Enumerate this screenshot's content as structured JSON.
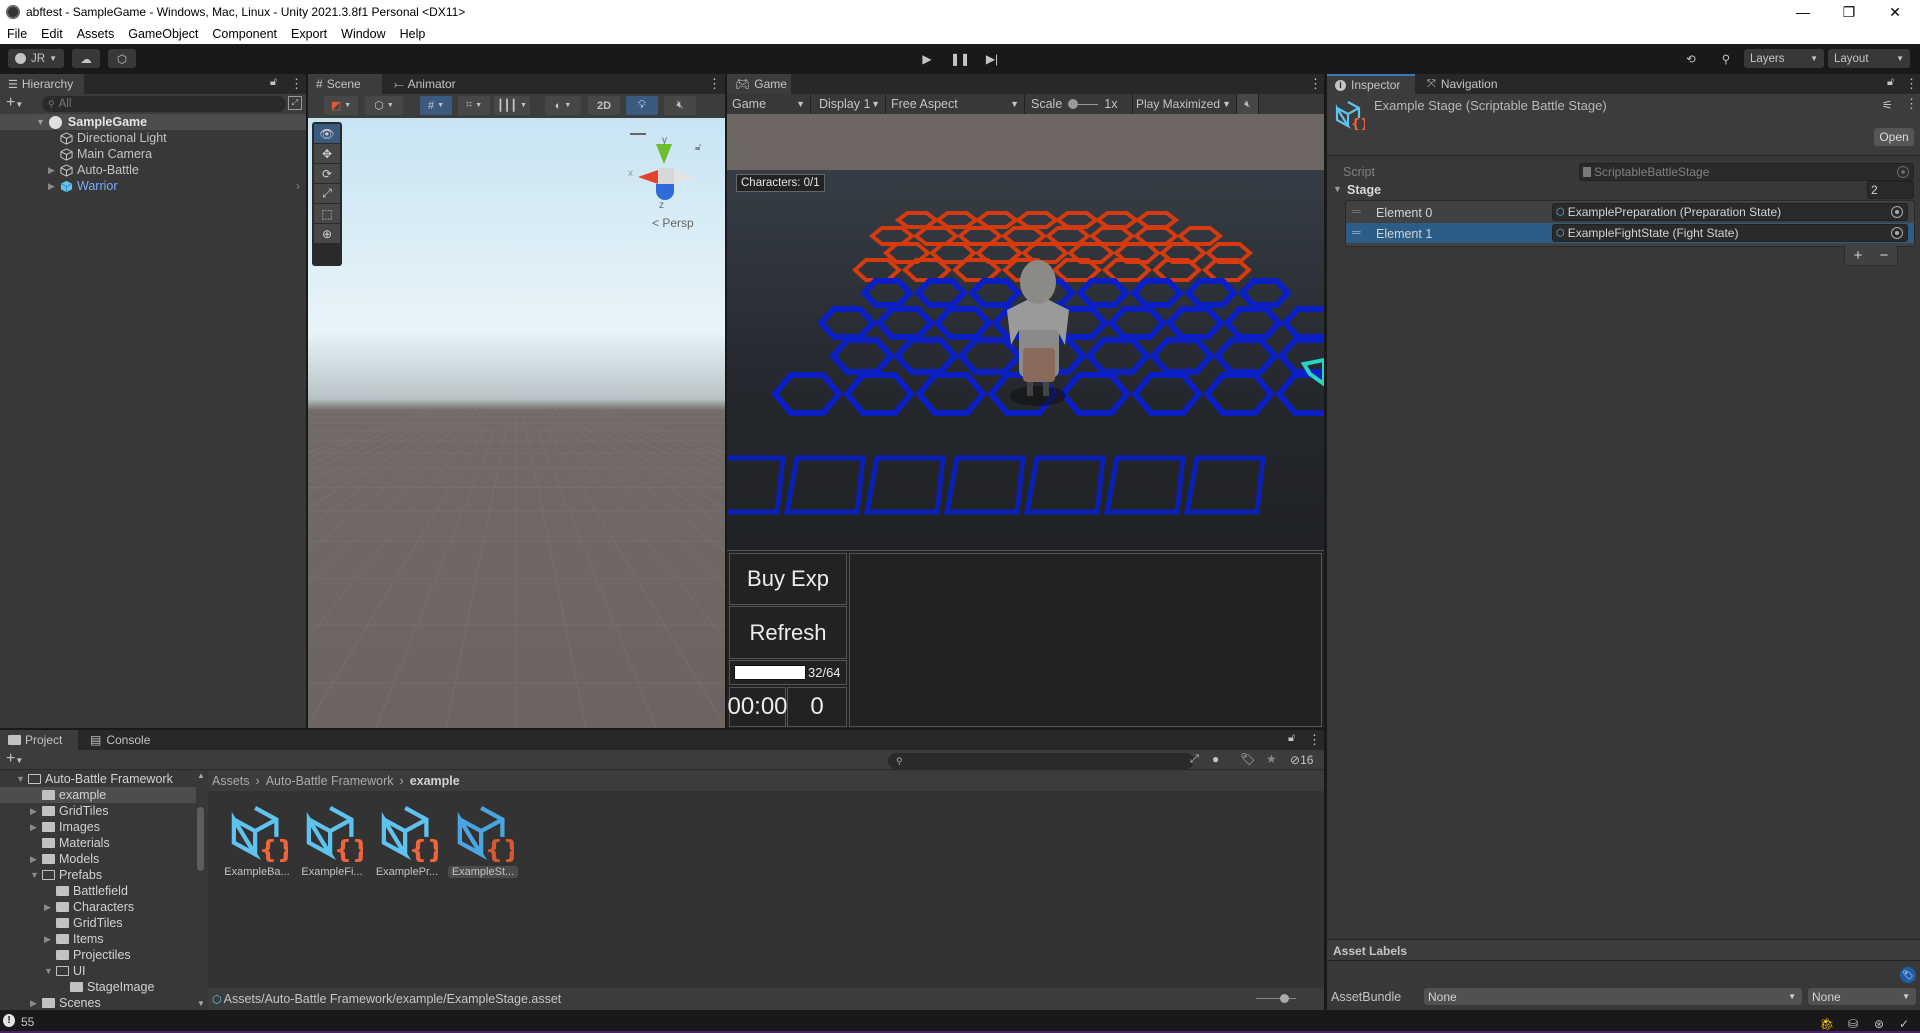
{
  "window": {
    "title": "abftest - SampleGame - Windows, Mac, Linux - Unity 2021.3.8f1 Personal <DX11>",
    "controls": {
      "minimize": "—",
      "maximize": "❐",
      "close": "✕"
    }
  },
  "menu": [
    "File",
    "Edit",
    "Assets",
    "GameObject",
    "Component",
    "Export",
    "Window",
    "Help"
  ],
  "toolbar": {
    "account_label": "JR",
    "cloud_icon": "cloud-icon",
    "collab_icon": "package-icon",
    "play_icons": [
      "play-icon",
      "pause-icon",
      "step-icon"
    ],
    "layers_label": "Layers",
    "layout_label": "Layout"
  },
  "hierarchy": {
    "tab_label": "Hierarchy",
    "search_placeholder": "All",
    "scene_name": "SampleGame",
    "items": [
      {
        "label": "Directional Light",
        "expandable": false,
        "prefab": false
      },
      {
        "label": "Main Camera",
        "expandable": false,
        "prefab": false
      },
      {
        "label": "Auto-Battle",
        "expandable": true,
        "prefab": false
      },
      {
        "label": "Warrior",
        "expandable": true,
        "prefab": true
      }
    ]
  },
  "scene": {
    "tabs": [
      {
        "label": "Scene",
        "icon": "grid-hash-icon"
      },
      {
        "label": "Animator",
        "icon": "animator-icon"
      }
    ],
    "toolbar": {
      "btn_2d": "2D"
    },
    "tools": [
      "view-tool",
      "move-tool",
      "rotate-tool",
      "scale-tool",
      "rect-tool",
      "transform-tool"
    ],
    "gizmo": {
      "x_label": "x",
      "y_label": "y",
      "z_label": "z",
      "projection_label": "< Persp"
    }
  },
  "game": {
    "tab_label": "Game",
    "view_dropdown": "Game",
    "display_dropdown": "Display 1",
    "aspect_dropdown": "Free Aspect",
    "scale_label": "Scale",
    "scale_value": "1x",
    "play_mode_dropdown": "Play Maximized",
    "overlay": {
      "characters_label": "Characters: 0/1",
      "buy_exp_label": "Buy Exp",
      "refresh_label": "Refresh",
      "exp_text": "32/64",
      "exp_progress": 1.0,
      "timer": "00:00",
      "gold": "0"
    },
    "colors": {
      "enemy_tiles": "#d63a0f",
      "player_tiles": "#0a1fc4",
      "bench_tiles": "#0a1fb4",
      "highlight": "#2ad4c0"
    }
  },
  "inspector": {
    "tabs": [
      {
        "label": "Inspector",
        "icon": "info-icon"
      },
      {
        "label": "Navigation",
        "icon": "navigation-icon"
      }
    ],
    "title": "Example Stage (Scriptable Battle Stage)",
    "open_button": "Open",
    "script_label": "Script",
    "script_value": "ScriptableBattleStage",
    "stage_label": "Stage",
    "stage_count": "2",
    "elements": [
      {
        "label": "Element 0",
        "value": "ExamplePreparation (Preparation State)",
        "selected": false
      },
      {
        "label": "Element 1",
        "value": "ExampleFightState (Fight State)",
        "selected": true
      }
    ],
    "add_label": "+",
    "remove_label": "−",
    "asset_labels_header": "Asset Labels",
    "assetbundle_label": "AssetBundle",
    "assetbundle_value": "None",
    "assetbundle_variant": "None"
  },
  "project": {
    "tabs": [
      {
        "label": "Project",
        "icon": "folder-icon"
      },
      {
        "label": "Console",
        "icon": "console-icon"
      }
    ],
    "tree": [
      {
        "label": "Auto-Battle Framework",
        "depth": 0,
        "state": "open"
      },
      {
        "label": "example",
        "depth": 1,
        "state": "none",
        "selected": true
      },
      {
        "label": "GridTiles",
        "depth": 1,
        "state": "closed"
      },
      {
        "label": "Images",
        "depth": 1,
        "state": "closed"
      },
      {
        "label": "Materials",
        "depth": 1,
        "state": "none"
      },
      {
        "label": "Models",
        "depth": 1,
        "state": "closed"
      },
      {
        "label": "Prefabs",
        "depth": 1,
        "state": "open"
      },
      {
        "label": "Battlefield",
        "depth": 2,
        "state": "none"
      },
      {
        "label": "Characters",
        "depth": 2,
        "state": "closed"
      },
      {
        "label": "GridTiles",
        "depth": 2,
        "state": "none"
      },
      {
        "label": "Items",
        "depth": 2,
        "state": "closed"
      },
      {
        "label": "Projectiles",
        "depth": 2,
        "state": "none"
      },
      {
        "label": "UI",
        "depth": 2,
        "state": "open"
      },
      {
        "label": "StageImage",
        "depth": 3,
        "state": "none"
      },
      {
        "label": "Scenes",
        "depth": 1,
        "state": "closed"
      }
    ],
    "breadcrumb": [
      "Assets",
      "Auto-Battle Framework",
      "example"
    ],
    "hidden_count": "16",
    "assets": [
      {
        "label": "ExampleBa...",
        "selected": false
      },
      {
        "label": "ExampleFi...",
        "selected": false
      },
      {
        "label": "ExamplePr...",
        "selected": false
      },
      {
        "label": "ExampleSt...",
        "selected": true
      }
    ],
    "selected_path": "Assets/Auto-Battle Framework/example/ExampleStage.asset"
  },
  "statusbar": {
    "message_count": "55"
  }
}
